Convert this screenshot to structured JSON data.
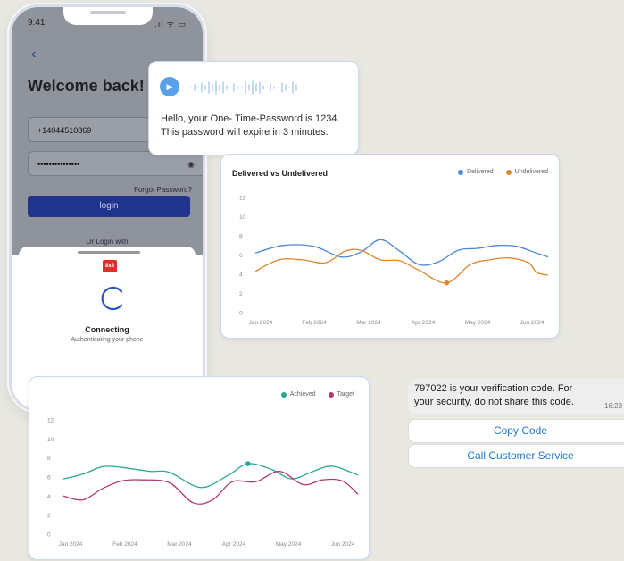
{
  "phone": {
    "status_time": "9:41",
    "status_icons": ".ıl ᯤ ▭",
    "back_icon": "chevron-left-icon",
    "title": "Welcome back!",
    "phone_number_value": "+14044510869",
    "password_value": "•••••••••••••••",
    "forgot_password": "Forgot Password?",
    "login_button": "login",
    "or_login_with": "Or Login with",
    "sheet": {
      "logo": "8x8",
      "connecting": "Connecting",
      "authenticating": "Authenticating your phone"
    }
  },
  "voice_card": {
    "play_icon": "play-icon",
    "message_line1": "Hello, your One- Time-Password is 1234.",
    "message_line2": "This password will expire in 3 minutes."
  },
  "chart1": {
    "title": "Delivered vs Undelivered",
    "legend": [
      "Delivered",
      "Undelivered"
    ]
  },
  "chart2": {
    "legend": [
      "Achieved",
      "Target"
    ]
  },
  "sms": {
    "line1": "797022 is your verification code. For",
    "line2": "your security, do not share this code.",
    "time": "16:23",
    "copy_code": "Copy Code",
    "call_service": "Call Customer Service"
  },
  "chart_data": [
    {
      "type": "line",
      "title": "Delivered vs Undelivered",
      "ylim": [
        0,
        12
      ],
      "yticks": [
        0,
        2,
        4,
        6,
        8,
        10,
        12
      ],
      "x_labels": [
        "Jan 2024",
        "Feb 2024",
        "Mar 2024",
        "Apr 2024",
        "May 2024",
        "Jun 2024"
      ],
      "colors": [
        "#4a86d4",
        "#e0852a"
      ],
      "series": [
        {
          "name": "Delivered",
          "points": [
            [
              0,
              6.2
            ],
            [
              0.7,
              7.0
            ],
            [
              1.5,
              6.9
            ],
            [
              2.2,
              5.8
            ],
            [
              2.7,
              6.3
            ],
            [
              3.2,
              7.6
            ],
            [
              3.7,
              6.4
            ],
            [
              4.2,
              5.0
            ],
            [
              4.7,
              5.3
            ],
            [
              5.2,
              6.5
            ],
            [
              5.7,
              6.7
            ],
            [
              6.2,
              7.0
            ],
            [
              6.7,
              6.9
            ],
            [
              7.2,
              6.2
            ],
            [
              7.5,
              5.8
            ]
          ]
        },
        {
          "name": "Undelivered",
          "points": [
            [
              0,
              4.3
            ],
            [
              0.6,
              5.5
            ],
            [
              1.2,
              5.5
            ],
            [
              1.8,
              5.2
            ],
            [
              2.3,
              6.4
            ],
            [
              2.7,
              6.5
            ],
            [
              3.2,
              5.5
            ],
            [
              3.7,
              5.4
            ],
            [
              4.2,
              4.4
            ],
            [
              4.9,
              3.1
            ],
            [
              5.5,
              5.0
            ],
            [
              6.0,
              5.5
            ],
            [
              6.5,
              5.7
            ],
            [
              7.0,
              5.2
            ],
            [
              7.2,
              4.2
            ],
            [
              7.5,
              3.9
            ]
          ]
        }
      ],
      "highlight": {
        "series": "Undelivered",
        "x": 4.9,
        "y": 3.1
      }
    },
    {
      "type": "line",
      "ylim": [
        0,
        12
      ],
      "yticks": [
        0,
        2,
        4,
        6,
        8,
        10,
        12
      ],
      "x_labels": [
        "Jan 2024",
        "Feb 2024",
        "Mar 2024",
        "Apr 2024",
        "May 2024",
        "Jun 2024"
      ],
      "colors": [
        "#2aa894",
        "#b0396f"
      ],
      "series": [
        {
          "name": "Achieved",
          "points": [
            [
              0,
              5.8
            ],
            [
              0.5,
              6.3
            ],
            [
              1.0,
              7.1
            ],
            [
              1.5,
              7.0
            ],
            [
              2.2,
              6.6
            ],
            [
              2.7,
              6.5
            ],
            [
              3.5,
              4.9
            ],
            [
              4.2,
              6.2
            ],
            [
              4.7,
              7.4
            ],
            [
              5.3,
              6.8
            ],
            [
              5.8,
              5.8
            ],
            [
              6.3,
              6.5
            ],
            [
              6.7,
              7.1
            ],
            [
              7.0,
              7.0
            ],
            [
              7.5,
              6.2
            ]
          ]
        },
        {
          "name": "Target",
          "points": [
            [
              0,
              4.0
            ],
            [
              0.5,
              3.6
            ],
            [
              1.0,
              4.8
            ],
            [
              1.5,
              5.6
            ],
            [
              2.0,
              5.7
            ],
            [
              2.7,
              5.4
            ],
            [
              3.3,
              3.3
            ],
            [
              3.8,
              3.6
            ],
            [
              4.3,
              5.5
            ],
            [
              4.9,
              5.5
            ],
            [
              5.5,
              6.6
            ],
            [
              6.1,
              5.2
            ],
            [
              6.6,
              5.7
            ],
            [
              7.1,
              5.6
            ],
            [
              7.5,
              4.2
            ]
          ]
        }
      ],
      "highlight": {
        "series": "Achieved",
        "x": 4.7,
        "y": 7.4
      }
    }
  ]
}
